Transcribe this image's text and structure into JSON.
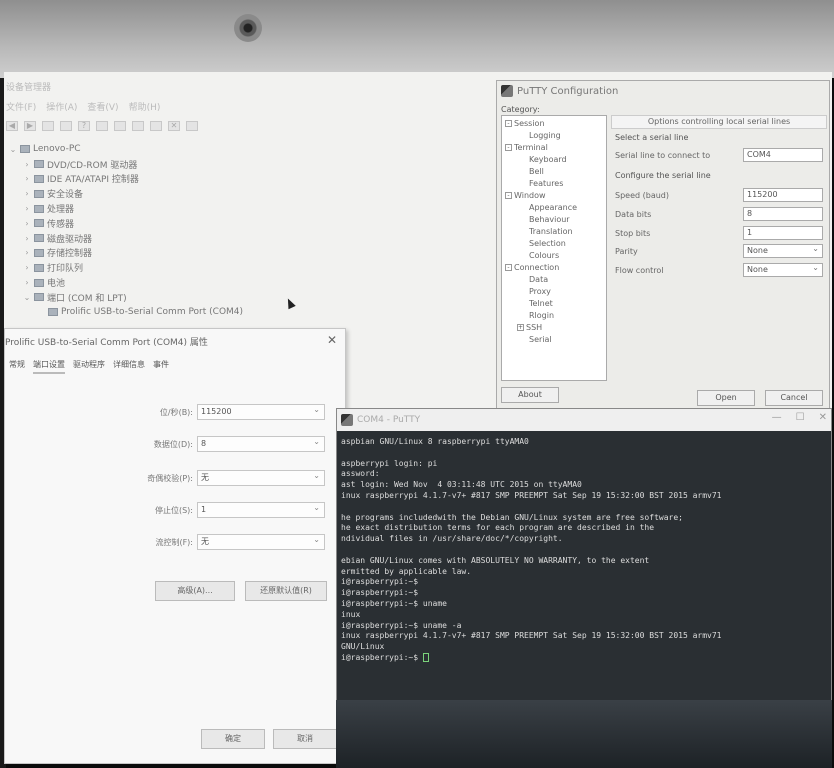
{
  "device_manager": {
    "title": "设备管理器",
    "menu": [
      "文件(F)",
      "操作(A)",
      "查看(V)",
      "帮助(H)"
    ],
    "tree": [
      {
        "label": "Lenovo-PC",
        "expanded": true,
        "level": 0
      },
      {
        "label": "DVD/CD-ROM 驱动器",
        "expanded": false,
        "level": 1
      },
      {
        "label": "IDE ATA/ATAPI 控制器",
        "expanded": false,
        "level": 1
      },
      {
        "label": "安全设备",
        "expanded": false,
        "level": 1
      },
      {
        "label": "处理器",
        "expanded": false,
        "level": 1
      },
      {
        "label": "传感器",
        "expanded": false,
        "level": 1
      },
      {
        "label": "磁盘驱动器",
        "expanded": false,
        "level": 1
      },
      {
        "label": "存储控制器",
        "expanded": false,
        "level": 1
      },
      {
        "label": "打印队列",
        "expanded": false,
        "level": 1
      },
      {
        "label": "电池",
        "expanded": false,
        "level": 1
      },
      {
        "label": "端口 (COM 和 LPT)",
        "expanded": true,
        "level": 1
      },
      {
        "label": "Prolific USB-to-Serial Comm Port (COM4)",
        "expanded": false,
        "level": 2
      }
    ]
  },
  "putty_config": {
    "title": "PuTTY Configuration",
    "category_label": "Category:",
    "categories": [
      {
        "label": "Session",
        "level": 0,
        "box": "-"
      },
      {
        "label": "Logging",
        "level": 2,
        "box": ""
      },
      {
        "label": "Terminal",
        "level": 0,
        "box": "-"
      },
      {
        "label": "Keyboard",
        "level": 2,
        "box": ""
      },
      {
        "label": "Bell",
        "level": 2,
        "box": ""
      },
      {
        "label": "Features",
        "level": 2,
        "box": ""
      },
      {
        "label": "Window",
        "level": 0,
        "box": "-"
      },
      {
        "label": "Appearance",
        "level": 2,
        "box": ""
      },
      {
        "label": "Behaviour",
        "level": 2,
        "box": ""
      },
      {
        "label": "Translation",
        "level": 2,
        "box": ""
      },
      {
        "label": "Selection",
        "level": 2,
        "box": ""
      },
      {
        "label": "Colours",
        "level": 2,
        "box": ""
      },
      {
        "label": "Connection",
        "level": 0,
        "box": "-"
      },
      {
        "label": "Data",
        "level": 2,
        "box": ""
      },
      {
        "label": "Proxy",
        "level": 2,
        "box": ""
      },
      {
        "label": "Telnet",
        "level": 2,
        "box": ""
      },
      {
        "label": "Rlogin",
        "level": 2,
        "box": ""
      },
      {
        "label": "SSH",
        "level": 1,
        "box": "+"
      },
      {
        "label": "Serial",
        "level": 2,
        "box": ""
      }
    ],
    "panel_title": "Options controlling local serial lines",
    "group1": "Select a serial line",
    "serial_line_label": "Serial line to connect to",
    "serial_line_value": "COM4",
    "group2": "Configure the serial line",
    "speed_label": "Speed (baud)",
    "speed_value": "115200",
    "data_bits_label": "Data bits",
    "data_bits_value": "8",
    "stop_bits_label": "Stop bits",
    "stop_bits_value": "1",
    "parity_label": "Parity",
    "parity_value": "None",
    "flow_label": "Flow control",
    "flow_value": "None",
    "about": "About",
    "open": "Open",
    "cancel": "Cancel"
  },
  "com_properties": {
    "title": "Prolific USB-to-Serial Comm Port (COM4) 属性",
    "tabs": [
      "常规",
      "端口设置",
      "驱动程序",
      "详细信息",
      "事件"
    ],
    "active_tab": 1,
    "bits_per_sec_label": "位/秒(B):",
    "bits_per_sec_value": "115200",
    "data_bits_label": "数据位(D):",
    "data_bits_value": "8",
    "parity_label": "奇偶校验(P):",
    "parity_value": "无",
    "stop_bits_label": "停止位(S):",
    "stop_bits_value": "1",
    "flow_label": "流控制(F):",
    "flow_value": "无",
    "advanced": "高级(A)...",
    "restore": "还原默认值(R)",
    "ok": "确定",
    "cancel": "取消"
  },
  "terminal": {
    "title": "COM4 - PuTTY",
    "lines": [
      "aspbian GNU/Linux 8 raspberrypi ttyAMA0",
      "",
      "aspberrypi login: pi",
      "assword:",
      "ast login: Wed Nov  4 03:11:48 UTC 2015 on ttyAMA0",
      "inux raspberrypi 4.1.7-v7+ #817 SMP PREEMPT Sat Sep 19 15:32:00 BST 2015 armv71",
      "",
      "he programs includedwith the Debian GNU/Linux system are free software;",
      "he exact distribution terms for each program are described in the",
      "ndividual files in /usr/share/doc/*/copyright.",
      "",
      "ebian GNU/Linux comes with ABSOLUTELY NO WARRANTY, to the extent",
      "ermitted by applicable law.",
      "i@raspberrypi:~$",
      "i@raspberrypi:~$",
      "i@raspberrypi:~$ uname",
      "inux",
      "i@raspberrypi:~$ uname -a",
      "inux raspberrypi 4.1.7-v7+ #817 SMP PREEMPT Sat Sep 19 15:32:00 BST 2015 armv71",
      "GNU/Linux",
      "i@raspberrypi:~$ "
    ]
  }
}
